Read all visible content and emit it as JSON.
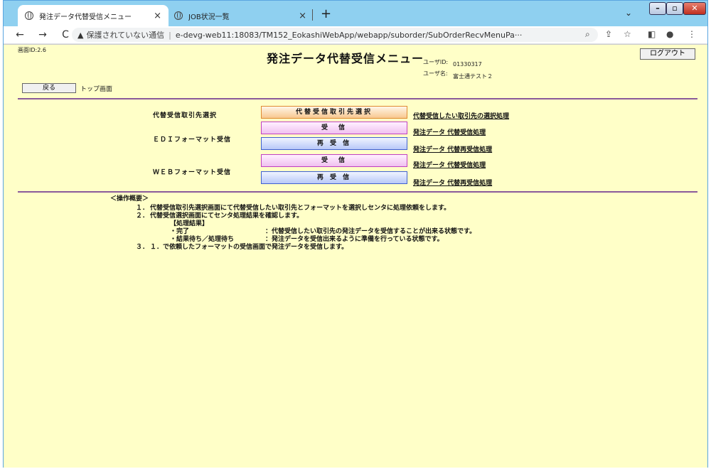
{
  "browser": {
    "tabs": [
      {
        "label": "発注データ代替受信メニュー",
        "active": true
      },
      {
        "label": "JOB状況一覧",
        "active": false
      }
    ],
    "new_tab": "+",
    "tab_menu": "⌄",
    "win_min": "–",
    "win_max": "▫",
    "win_close": "✕",
    "nav_back": "←",
    "nav_forward": "→",
    "nav_reload": "C",
    "not_secure": "保護されていない通信",
    "url": "e-devg-web11:18083/TM152_EokashiWebApp/webapp/suborder/SubOrderRecvMenuPa···",
    "icons": [
      "zoom-icon",
      "share-icon",
      "star-icon",
      "sidepanel-icon",
      "profile-icon",
      "menu-icon"
    ]
  },
  "page": {
    "screen_id": "画面ID:2.6",
    "title": "発注データ代替受信メニュー",
    "logout": "ログアウト",
    "user_id_label": "ユーザID:",
    "user_id_value": "01330317",
    "user_name_label": "ユーザ名:",
    "user_name_value": "富士通テスト２",
    "back_button": "戻る",
    "back_label": "トップ画面"
  },
  "menu": {
    "partner_label": "代替受信取引先選択",
    "partner_button": "代替受信取引先選択",
    "partner_link": "代替受信したい取引先の選択処理",
    "edi_label": "ＥＤＩフォーマット受信",
    "edi_recv_button": "受　信",
    "edi_recv_link": "発注データ 代替受信処理",
    "edi_rerecv_button": "再 受 信",
    "edi_rerecv_link": "発注データ 代替再受信処理",
    "web_label": "ＷＥＢフォーマット受信",
    "web_recv_button": "受　信",
    "web_recv_link": "発注データ 代替受信処理",
    "web_rerecv_button": "再 受 信",
    "web_rerecv_link": "発注データ 代替再受信処理"
  },
  "overview": {
    "title": "＜操作概要＞",
    "steps": [
      {
        "num": "１．",
        "text": "代替受信取引先選択画面にて代替受信したい取引先とフォーマットを選択しセンタに処理依頼をします。"
      },
      {
        "num": "２．",
        "text": "代替受信選択画面にてセンタ処理結果を確認します。"
      }
    ],
    "result_title": "【処理結果】",
    "results": [
      {
        "label": "・完了",
        "text": "：代替受信したい取引先の発注データを受信することが出来る状態です。"
      },
      {
        "label": "・結果待ち／処理待ち",
        "text": "：発注データを受信出来るように準備を行っている状態です。"
      }
    ],
    "step3": {
      "num": "３．",
      "text": "１．で依頼したフォーマットの受信画面で発注データを受信します。"
    }
  }
}
